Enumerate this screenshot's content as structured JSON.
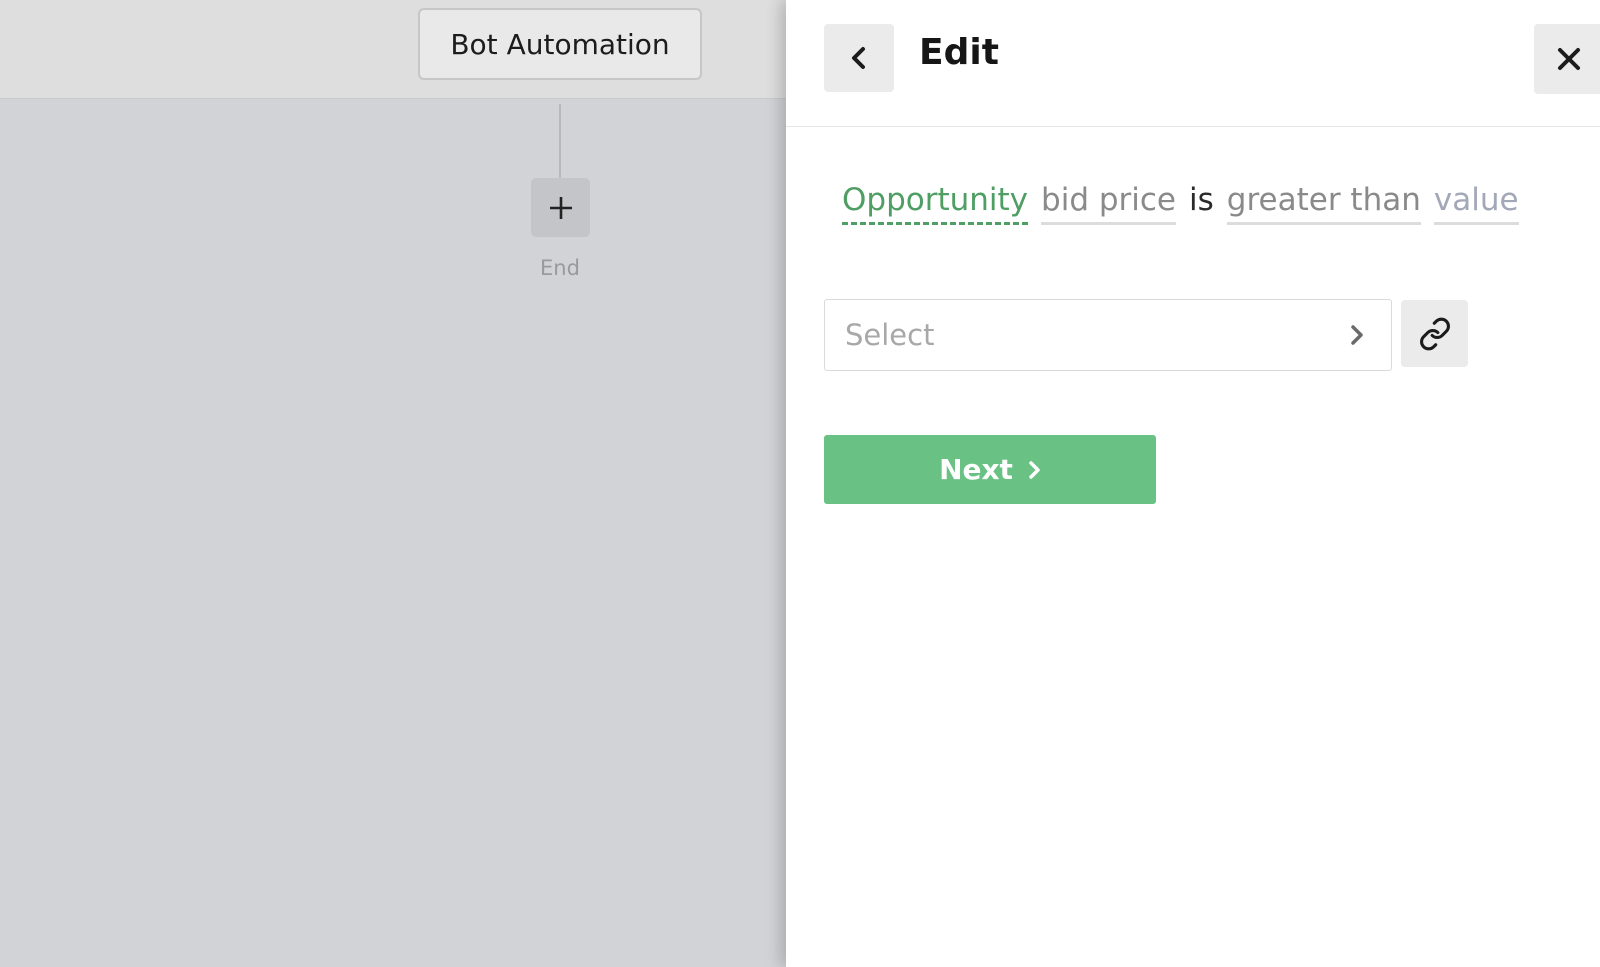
{
  "canvas": {
    "bot_node_label": "Bot Automation",
    "add_step_icon": "plus-icon",
    "end_label": "End"
  },
  "panel": {
    "back_icon": "chevron-left-icon",
    "title": "Edit",
    "close_icon": "close-icon",
    "condition": {
      "entity": "Opportunity",
      "field": "bid price",
      "operator": "is",
      "comparison": "greater than",
      "value": "value"
    },
    "select": {
      "placeholder": "Select",
      "chevron_icon": "chevron-right-icon"
    },
    "link_icon": "link-icon",
    "next_button": {
      "label": "Next",
      "icon": "chevron-right-icon"
    }
  },
  "colors": {
    "accent_green": "#69c283",
    "entity_green": "#4f9e64",
    "canvas_gray": "#d2d3d6"
  }
}
